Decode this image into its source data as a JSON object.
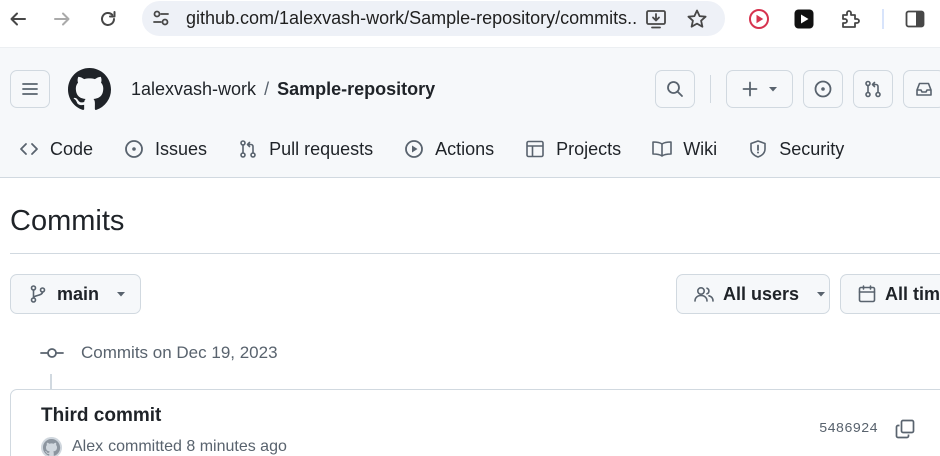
{
  "browser": {
    "url": "github.com/1alexvash-work/Sample-repository/commits..."
  },
  "repo": {
    "owner": "1alexvash-work",
    "separator": "/",
    "name": "Sample-repository"
  },
  "nav": {
    "tabs": [
      {
        "label": "Code",
        "icon": "code-icon"
      },
      {
        "label": "Issues",
        "icon": "issue-opened-icon"
      },
      {
        "label": "Pull requests",
        "icon": "git-pull-request-icon"
      },
      {
        "label": "Actions",
        "icon": "play-icon"
      },
      {
        "label": "Projects",
        "icon": "table-icon"
      },
      {
        "label": "Wiki",
        "icon": "book-icon"
      },
      {
        "label": "Security",
        "icon": "shield-icon"
      }
    ]
  },
  "page": {
    "title": "Commits"
  },
  "filters": {
    "branch": "main",
    "users": "All users",
    "time": "All time"
  },
  "commit_groups": [
    {
      "heading": "Commits on Dec 19, 2023",
      "commits": [
        {
          "title": "Third commit",
          "author": "Alex",
          "meta": "committed 8 minutes ago",
          "sha": "5486924"
        }
      ]
    }
  ],
  "colors": {
    "header_bg": "#f6f8fa",
    "border": "#d1d9e0",
    "text": "#1f2328",
    "muted": "#59636e",
    "omnibox_bg": "#eef1f7"
  }
}
